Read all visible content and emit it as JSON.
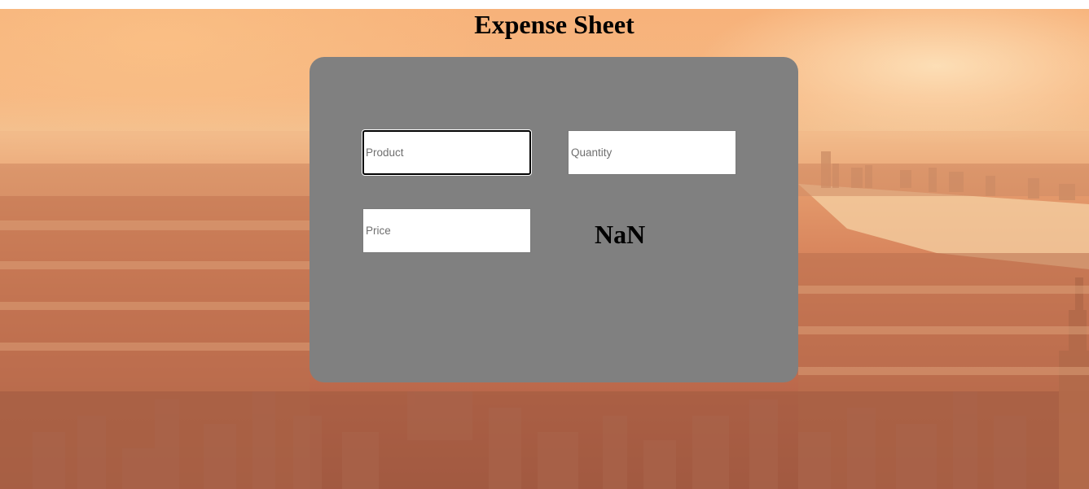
{
  "page": {
    "title": "Expense Sheet"
  },
  "form": {
    "product": {
      "placeholder": "Product",
      "value": ""
    },
    "quantity": {
      "placeholder": "Quantity",
      "value": ""
    },
    "price": {
      "placeholder": "Price",
      "value": ""
    },
    "total": "NaN"
  },
  "colors": {
    "panel": "#808080",
    "background_tint": "#f3b27a",
    "title": "#000000"
  }
}
